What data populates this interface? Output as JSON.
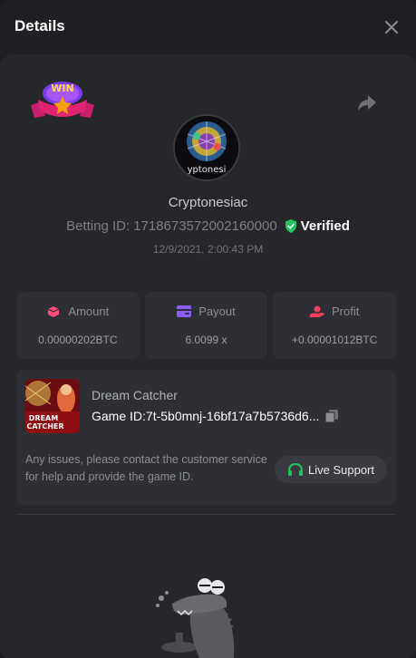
{
  "header": {
    "title": "Details"
  },
  "badge": {
    "text": "WIN"
  },
  "player": {
    "avatar_text": "yptonesi",
    "username": "Cryptonesiac",
    "betting_label": "Betting ID:",
    "betting_id": "1718673572002160000",
    "verified_label": "Verified",
    "date": "12/9/2021, 2:00:43 PM"
  },
  "stats": [
    {
      "label": "Amount",
      "value": "0.00000202BTC"
    },
    {
      "label": "Payout",
      "value": "6.0099 x"
    },
    {
      "label": "Profit",
      "value": "+0.00001012BTC"
    }
  ],
  "game": {
    "thumb_text_top": "DREAM",
    "thumb_text_bottom": "CATCHER",
    "name": "Dream Catcher",
    "id_label": "Game ID:",
    "id_value": "7t-5b0mnj-16bf17a7b5736d6...",
    "issue_text": "Any issues, please contact the customer service for help and provide the game ID.",
    "support_label": "Live Support"
  },
  "colors": {
    "background": "#1f2023",
    "panel": "#26272b",
    "card": "#2e2f34",
    "verified_green": "#22c55e",
    "amount_pink": "#ff4d7a",
    "payout_purple": "#8b5cf6",
    "profit_red": "#f43f5e"
  }
}
